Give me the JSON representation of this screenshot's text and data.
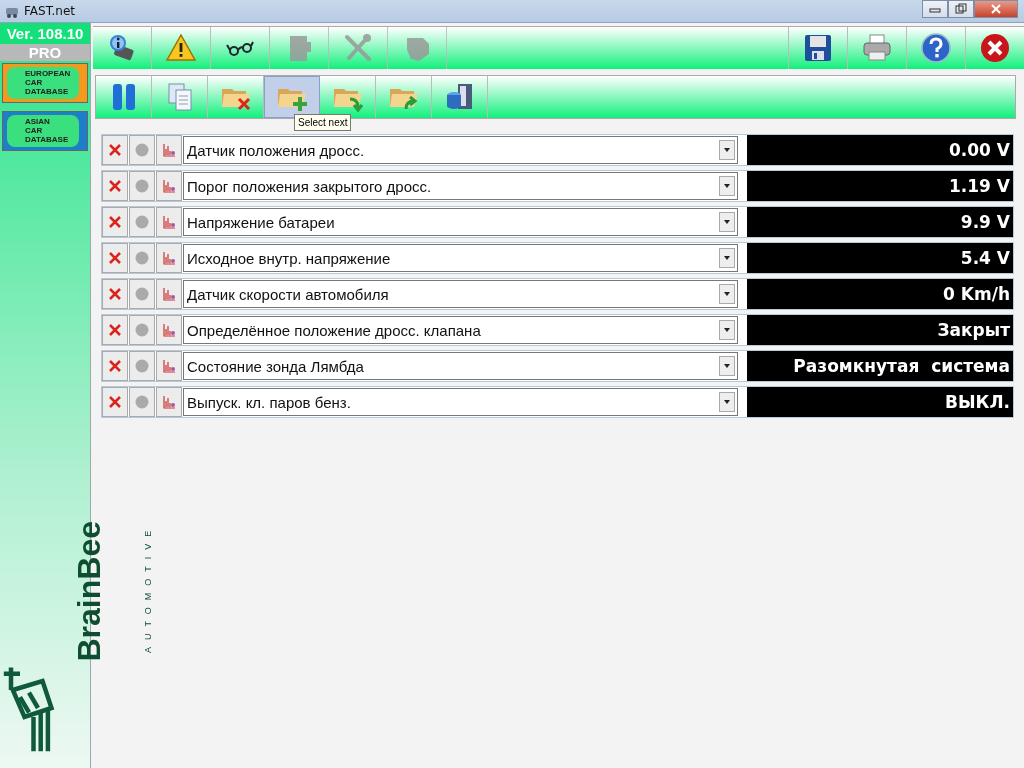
{
  "window": {
    "title": "FAST.net"
  },
  "sidebar": {
    "version": "Ver. 108.10",
    "edition": "PRO",
    "databases": [
      {
        "label": "EUROPEAN CAR DATABASE",
        "color": "#f39a1e"
      },
      {
        "label": "ASIAN CAR DATABASE",
        "color": "#1e7fc8"
      }
    ],
    "logo": {
      "name": "BrainBee",
      "tagline": "AUTOMOTIVE"
    }
  },
  "main_toolbar": {
    "left": [
      {
        "kind": "info",
        "disabled": false
      },
      {
        "kind": "warning",
        "disabled": false
      },
      {
        "kind": "glasses",
        "disabled": false
      },
      {
        "kind": "module",
        "disabled": true
      },
      {
        "kind": "tools",
        "disabled": true
      },
      {
        "kind": "engine",
        "disabled": true
      }
    ],
    "right": [
      {
        "kind": "save",
        "disabled": false
      },
      {
        "kind": "print",
        "disabled": false
      },
      {
        "kind": "help",
        "disabled": false
      },
      {
        "kind": "exit",
        "disabled": false
      }
    ]
  },
  "sub_toolbar": {
    "items": [
      {
        "kind": "pause",
        "selected": false
      },
      {
        "kind": "copy",
        "selected": false
      },
      {
        "kind": "folder-delete",
        "selected": false
      },
      {
        "kind": "folder-add",
        "selected": true
      },
      {
        "kind": "folder-down",
        "selected": false
      },
      {
        "kind": "folder-up",
        "selected": false
      },
      {
        "kind": "database",
        "selected": false
      }
    ],
    "tooltip": "Select next"
  },
  "parameters": [
    {
      "label": "Датчик положения дросс.",
      "value": "0.00 V"
    },
    {
      "label": "Порог положения закрытого дросс.",
      "value": "1.19 V"
    },
    {
      "label": "Напряжение батареи",
      "value": "9.9 V"
    },
    {
      "label": "Исходное внутр. напряжение",
      "value": "5.4 V"
    },
    {
      "label": "Датчик скорости автомобиля",
      "value": "0 Km/h"
    },
    {
      "label": "Определённое положение дросс. клапана",
      "value": "Закрыт"
    },
    {
      "label": "Состояние зонда Лямбда",
      "value": "Разомкнутая  система"
    },
    {
      "label": "Выпуск.  кл. паров бенз.",
      "value": "ВЫКЛ."
    }
  ]
}
